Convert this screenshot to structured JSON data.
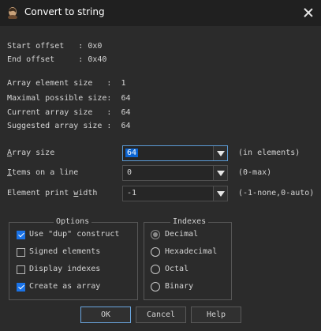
{
  "window": {
    "title": "Convert to string"
  },
  "info": {
    "start_offset": "Start offset   : 0x0",
    "end_offset": "End offset     : 0x40",
    "array_element_size": "Array element size   :  1",
    "maximal_possible_size": "Maximal possible size:  64",
    "current_array_size": "Current array size   :  64",
    "suggested_array_size": "Suggested array size :  64"
  },
  "fields": {
    "array_size": {
      "label_ul": "A",
      "label_rest": "rray size",
      "value": "64",
      "hint": "(in elements)"
    },
    "items_on_line": {
      "label_ul": "I",
      "label_rest": "tems on a line",
      "value": "0",
      "hint": "(0-max)"
    },
    "element_print_width": {
      "label_pre": "Element print ",
      "label_ul": "w",
      "label_rest": "idth",
      "value": "-1",
      "hint": "(-1-none,0-auto)"
    }
  },
  "options": {
    "legend": "Options",
    "items": [
      {
        "label": "Use \"dup\" construct",
        "checked": true
      },
      {
        "label": "Signed elements",
        "checked": false
      },
      {
        "label": "Display indexes",
        "checked": false
      },
      {
        "label": "Create as array",
        "checked": true
      }
    ]
  },
  "indexes": {
    "legend": "Indexes",
    "items": [
      {
        "label": "Decimal",
        "selected": true
      },
      {
        "label": "Hexadecimal",
        "selected": false
      },
      {
        "label": "Octal",
        "selected": false
      },
      {
        "label": "Binary",
        "selected": false
      }
    ]
  },
  "buttons": {
    "ok": "OK",
    "cancel": "Cancel",
    "help": "Help"
  }
}
